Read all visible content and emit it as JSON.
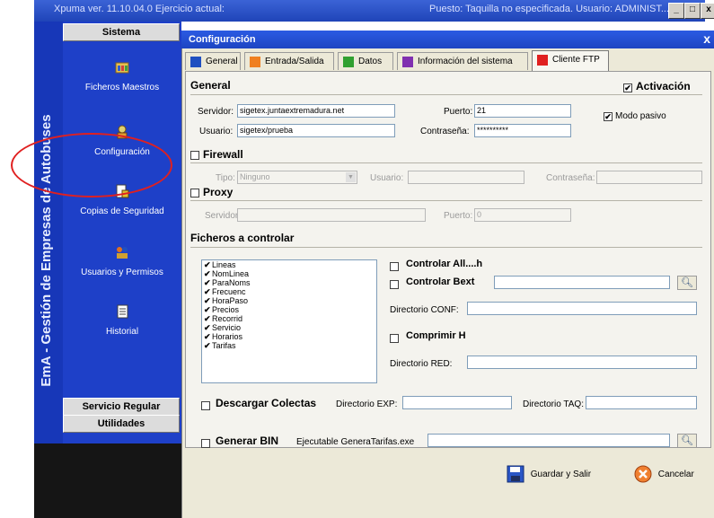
{
  "window": {
    "title": "Xpuma ver. 11.10.04.0 Ejercicio actual:",
    "status": "Puesto: Taquilla no especificada. Usuario: ADMINIST...",
    "minimize": "_",
    "restore": "□",
    "close": "x"
  },
  "sidebar": {
    "vertical_title": "EmA - Gestión de Empresas de Autobuses",
    "section_top": "Sistema",
    "items": [
      {
        "label": "Ficheros Maestros",
        "icon": "folders-icon"
      },
      {
        "label": "Configuración",
        "icon": "config-icon"
      },
      {
        "label": "Copias de Seguridad",
        "icon": "backup-icon"
      },
      {
        "label": "Usuarios y Permisos",
        "icon": "users-icon"
      },
      {
        "label": "Historial",
        "icon": "history-icon"
      }
    ],
    "section_mid": "Servicio Regular",
    "section_bottom": "Utilidades"
  },
  "dialog": {
    "title": "Configuración",
    "close": "x",
    "tabs": [
      {
        "label": "General",
        "color": "#2050c0"
      },
      {
        "label": "Entrada/Salida",
        "color": "#f08020"
      },
      {
        "label": "Datos",
        "color": "#30a030"
      },
      {
        "label": "Información del sistema",
        "color": "#8030b0"
      },
      {
        "label": "Cliente FTP",
        "color": "#e02020",
        "active": true
      }
    ],
    "general": {
      "heading": "General",
      "activacion": {
        "label": "Activación",
        "checked": "✔"
      },
      "servidor_label": "Servidor:",
      "servidor_value": "sigetex.juntaextremadura.net",
      "usuario_label": "Usuario:",
      "usuario_value": "sigetex/prueba",
      "puerto_label": "Puerto:",
      "puerto_value": "21",
      "contrasena_label": "Contraseña:",
      "contrasena_value": "**********",
      "modo_pasivo": {
        "label": "Modo pasivo",
        "checked": "✔"
      }
    },
    "firewall": {
      "heading": "Firewall",
      "tipo_label": "Tipo:",
      "tipo_value": "Ninguno",
      "usuario_label": "Usuario:",
      "contrasena_label": "Contraseña:"
    },
    "proxy": {
      "heading": "Proxy",
      "servidor_label": "Servidor:",
      "puerto_label": "Puerto:",
      "puerto_value": "0"
    },
    "ficheros": {
      "heading": "Ficheros a controlar",
      "list": [
        "Lineas",
        "NomLinea",
        "ParaNoms",
        "Frecuenc",
        "HoraPaso",
        "Precios",
        "Recorrid",
        "Servicio",
        "Horarios",
        "Tarifas"
      ],
      "checkmark": "✔",
      "controlar_all": "Controlar All....h",
      "controlar_bext": "Controlar Bext",
      "directorio_conf": "Directorio CONF:",
      "comprimir": "Comprimir H",
      "directorio_red": "Directorio RED:"
    },
    "descargar": {
      "label": "Descargar Colectas",
      "dir_exp": "Directorio EXP:",
      "dir_taq": "Directorio TAQ:"
    },
    "generar": {
      "label": "Generar BIN",
      "ejecutable": "Ejecutable GeneraTarifas.exe"
    },
    "buttons": {
      "save": "Guardar y Salir",
      "cancel": "Cancelar"
    }
  }
}
